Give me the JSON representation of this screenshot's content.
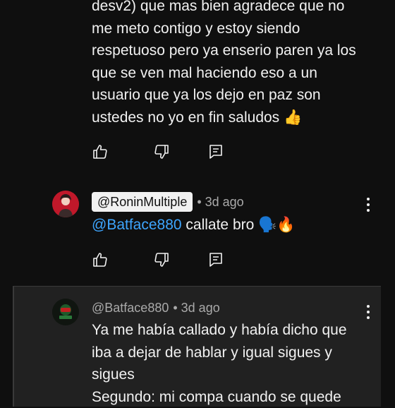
{
  "comment1": {
    "lines": [
      "desv2) que mas bien agradece que no",
      "me meto contigo y estoy siendo",
      "respetuoso pero ya enserio paren ya los",
      "que se ven mal haciendo eso a un",
      "usuario que ya los dejo en paz son",
      "ustedes no yo en fin saludos 👍"
    ]
  },
  "comment2": {
    "author": "@RoninMultiple",
    "time": "• 3d ago",
    "mention": "@Batface880",
    "text": " callate bro 🗣️🔥"
  },
  "comment3": {
    "author": "@Batface880",
    "time": "• 3d ago",
    "lines": [
      "Ya me había callado y había dicho que",
      "iba a dejar de hablar y igual sigues y",
      "sigues",
      "Segundo: mi compa cuando se quede"
    ]
  },
  "icons": {
    "like": "thumbs-up-icon",
    "dislike": "thumbs-down-icon",
    "reply": "reply-comment-icon",
    "menu": "more-vertical-icon"
  },
  "colors": {
    "background": "#0f0f0f",
    "panel": "#212121",
    "text": "#f1f1f1",
    "muted": "#aaaaaa",
    "mention": "#3ea6ff"
  }
}
